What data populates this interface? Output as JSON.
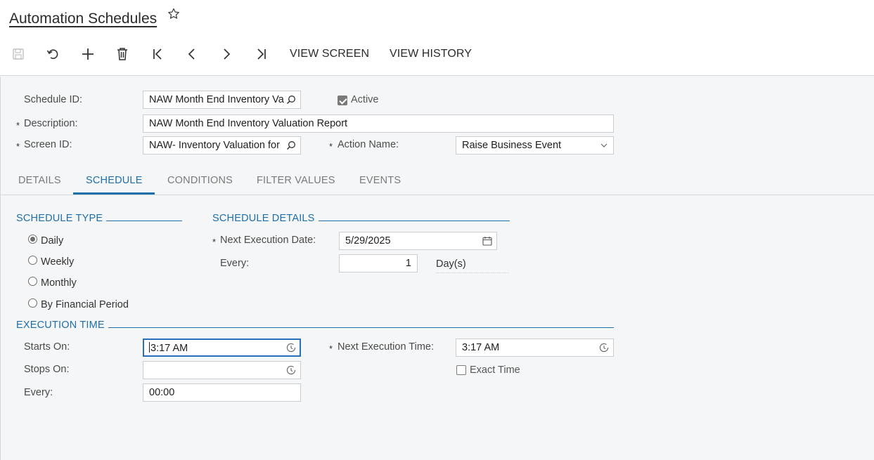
{
  "header": {
    "title": "Automation Schedules",
    "favorite_icon": "star-icon",
    "toolbar": {
      "icons": [
        "save-icon",
        "undo-icon",
        "add-icon",
        "delete-icon",
        "first-record-icon",
        "previous-record-icon",
        "next-record-icon",
        "last-record-icon"
      ],
      "view_screen_label": "VIEW SCREEN",
      "view_history_label": "VIEW HISTORY"
    }
  },
  "form": {
    "schedule_id": {
      "label": "Schedule ID:",
      "value": "NAW Month End Inventory Va"
    },
    "active": {
      "label": "Active",
      "checked": true
    },
    "description": {
      "label": "Description:",
      "value": "NAW Month End Inventory Valuation Report"
    },
    "screen_id": {
      "label": "Screen ID:",
      "value": "NAW- Inventory Valuation for"
    },
    "action_name": {
      "label": "Action Name:",
      "value": "Raise Business Event"
    },
    "required_marker": "*"
  },
  "tabs": [
    {
      "label": "DETAILS",
      "active": false
    },
    {
      "label": "SCHEDULE",
      "active": true
    },
    {
      "label": "CONDITIONS",
      "active": false
    },
    {
      "label": "FILTER VALUES",
      "active": false
    },
    {
      "label": "EVENTS",
      "active": false
    }
  ],
  "schedule": {
    "schedule_type": {
      "title": "SCHEDULE TYPE",
      "options": [
        {
          "label": "Daily",
          "checked": true
        },
        {
          "label": "Weekly",
          "checked": false
        },
        {
          "label": "Monthly",
          "checked": false
        },
        {
          "label": "By Financial Period",
          "checked": false
        }
      ]
    },
    "schedule_details": {
      "title": "SCHEDULE DETAILS",
      "next_execution_date": {
        "label": "Next Execution Date:",
        "value": "5/29/2025"
      },
      "every": {
        "label": "Every:",
        "value": "1",
        "unit": "Day(s)"
      }
    },
    "execution_time": {
      "title": "EXECUTION TIME",
      "starts_on": {
        "label": "Starts On:",
        "value": "3:17 AM"
      },
      "stops_on": {
        "label": "Stops On:",
        "value": ""
      },
      "every": {
        "label": "Every:",
        "value": "00:00"
      },
      "next_execution_time": {
        "label": "Next Execution Time:",
        "value": "3:17 AM"
      },
      "exact_time": {
        "label": "Exact Time",
        "checked": false
      }
    }
  },
  "colors": {
    "accent": "#1f6ea8",
    "focus_border": "#2a6ebb",
    "background": "#f5f6f7"
  }
}
